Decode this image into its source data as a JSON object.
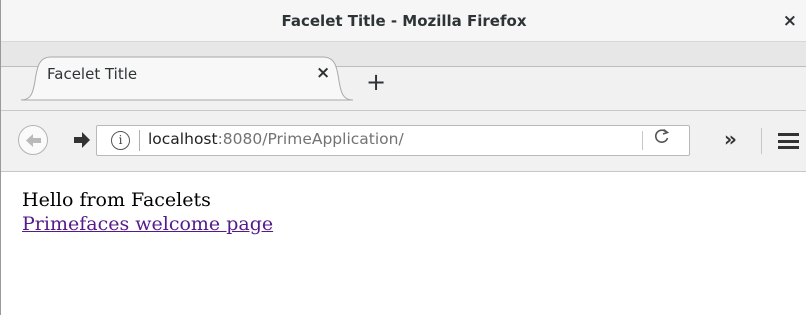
{
  "window": {
    "title": "Facelet Title - Mozilla Firefox",
    "close_glyph": "×"
  },
  "tabs": [
    {
      "label": "Facelet Title",
      "close_glyph": "×"
    }
  ],
  "new_tab_glyph": "+",
  "navbar": {
    "url_host": "localhost",
    "url_rest": ":8080/PrimeApplication/",
    "info_glyph": "i",
    "reload_glyph": "C",
    "overflow_glyph": "»"
  },
  "page": {
    "greeting": "Hello from Facelets",
    "link_text": "Primefaces welcome page"
  },
  "colors": {
    "link_visited": "#551a8b",
    "title_bar": "#f6f6f6",
    "toolbar": "#f1f1f1"
  }
}
